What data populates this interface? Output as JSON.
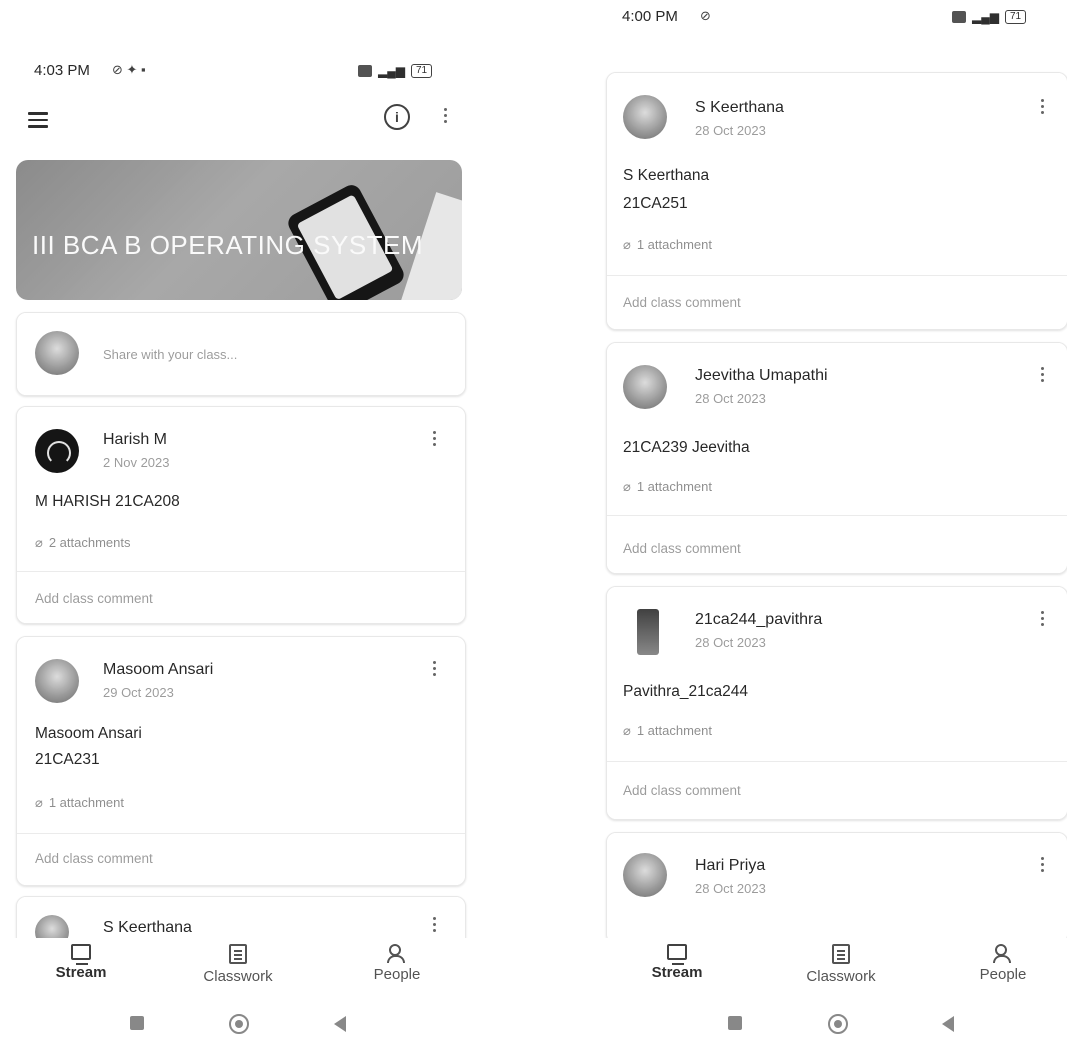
{
  "left": {
    "status": {
      "time": "4:03 PM"
    },
    "class_banner_title": "III BCA B  OPERATING SYSTEM",
    "share_placeholder": "Share with your class...",
    "posts": [
      {
        "author": "Harish M",
        "date": "2 Nov 2023",
        "lines": [
          "M HARISH 21CA208"
        ],
        "attachments": "2 attachments",
        "comment": "Add class comment"
      },
      {
        "author": "Masoom Ansari",
        "date": "29 Oct 2023",
        "lines": [
          "Masoom Ansari",
          "21CA231"
        ],
        "attachments": "1 attachment",
        "comment": "Add class comment"
      },
      {
        "author": "S Keerthana"
      }
    ],
    "nav": {
      "stream": "Stream",
      "classwork": "Classwork",
      "people": "People"
    }
  },
  "right": {
    "status": {
      "time": "4:00 PM"
    },
    "posts": [
      {
        "author": "S Keerthana",
        "date": "28 Oct 2023",
        "lines": [
          "S Keerthana",
          "21CA251"
        ],
        "attachments": "1 attachment",
        "comment": "Add class comment"
      },
      {
        "author": "Jeevitha Umapathi",
        "date": "28 Oct 2023",
        "lines": [
          "21CA239 Jeevitha"
        ],
        "attachments": "1 attachment",
        "comment": "Add class comment"
      },
      {
        "author": "21ca244_pavithra",
        "date": "28 Oct 2023",
        "lines": [
          "Pavithra_21ca244"
        ],
        "attachments": "1 attachment",
        "comment": "Add class comment"
      },
      {
        "author": "Hari Priya",
        "date": "28 Oct 2023"
      }
    ],
    "nav": {
      "stream": "Stream",
      "classwork": "Classwork",
      "people": "People"
    }
  },
  "status_battery": "71",
  "icons": [
    "menu-icon",
    "info-icon",
    "more-vert-icon",
    "attachment-icon",
    "stream-icon",
    "classwork-icon",
    "people-icon"
  ]
}
